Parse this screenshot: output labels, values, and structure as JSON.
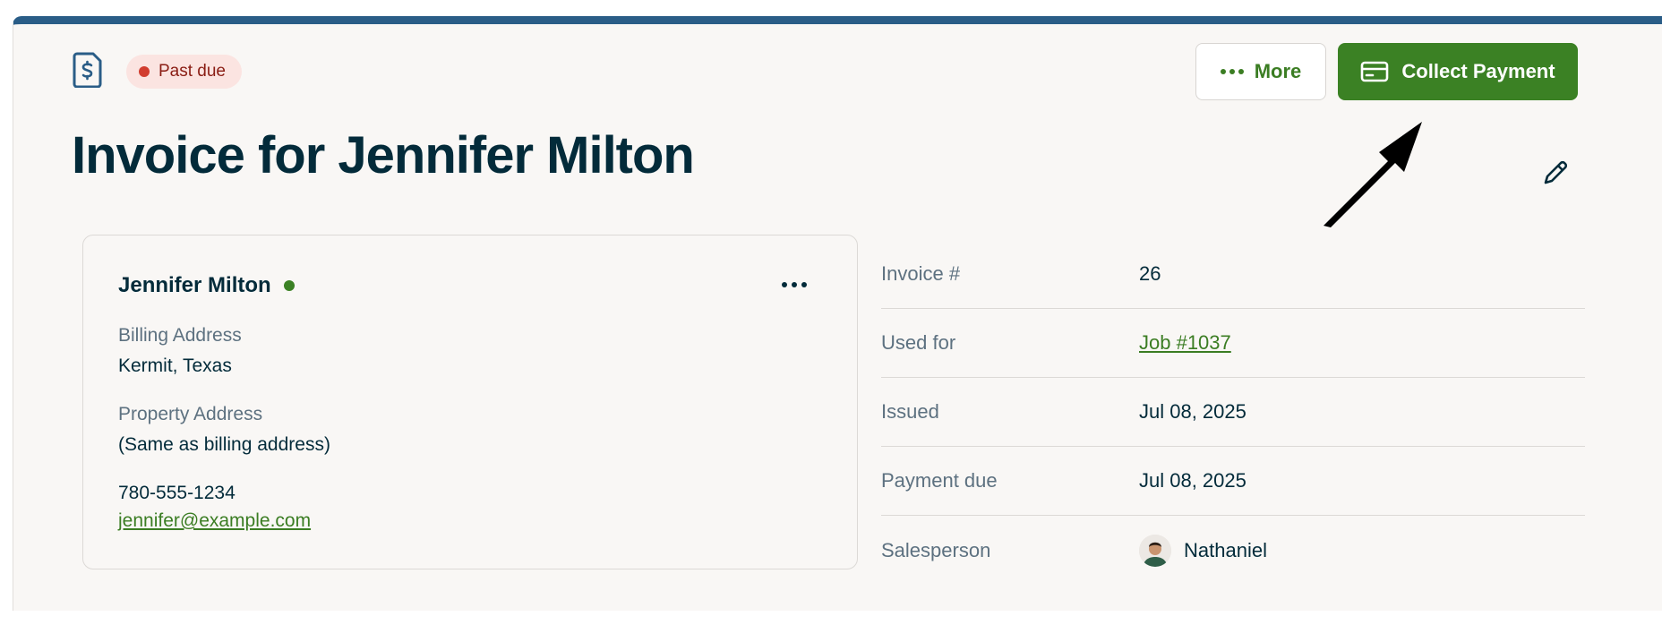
{
  "status": {
    "label": "Past due",
    "color": "#d13d2f"
  },
  "header": {
    "more_label": "More",
    "collect_label": "Collect Payment",
    "title": "Invoice for Jennifer Milton"
  },
  "client": {
    "name": "Jennifer Milton",
    "billing_label": "Billing Address",
    "billing_value": "Kermit, Texas",
    "property_label": "Property Address",
    "property_value": "(Same as billing address)",
    "phone": "780-555-1234",
    "email": "jennifer@example.com"
  },
  "details": [
    {
      "label": "Invoice #",
      "value": "26"
    },
    {
      "label": "Used for",
      "value": "Job #1037"
    },
    {
      "label": "Issued",
      "value": "Jul 08, 2025"
    },
    {
      "label": "Payment due",
      "value": "Jul 08, 2025"
    },
    {
      "label": "Salesperson",
      "value": "Nathaniel"
    }
  ],
  "colors": {
    "accent_green": "#3b8124",
    "top_border": "#2a5d87",
    "title": "#032b3a"
  },
  "icons": [
    "invoice-dollar-icon",
    "more-dots-icon",
    "credit-card-icon",
    "pencil-icon",
    "ellipsis-icon",
    "annotation-arrow-icon"
  ]
}
